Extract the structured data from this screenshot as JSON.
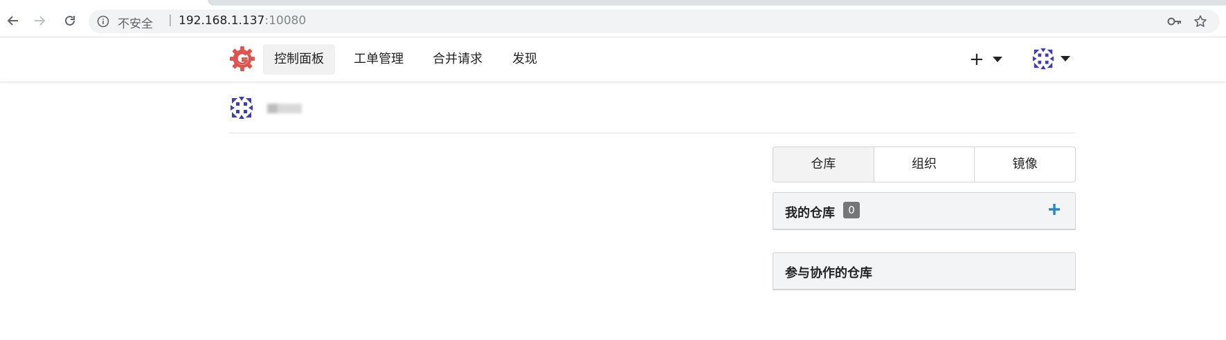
{
  "browser": {
    "security_label": "不安全",
    "separator": "|",
    "url_host": "192.168.1.137",
    "url_port": ":10080",
    "icons": [
      "back-icon",
      "forward-icon",
      "reload-icon",
      "info-icon",
      "key-icon",
      "star-icon"
    ]
  },
  "header": {
    "nav": [
      {
        "label": "控制面板",
        "active": true
      },
      {
        "label": "工单管理",
        "active": false
      },
      {
        "label": "合并请求",
        "active": false
      },
      {
        "label": "发现",
        "active": false
      }
    ],
    "create_label": "+",
    "brand_color": "#e0534d"
  },
  "profile": {
    "name": "▇▇▇"
  },
  "right_panel": {
    "tabs": [
      {
        "label": "仓库",
        "active": true
      },
      {
        "label": "组织",
        "active": false
      },
      {
        "label": "镜像",
        "active": false
      }
    ],
    "my_repos": {
      "title": "我的仓库",
      "count": "0"
    },
    "collab_repos": {
      "title": "参与协作的仓库"
    },
    "accent_color": "#2185d0"
  }
}
